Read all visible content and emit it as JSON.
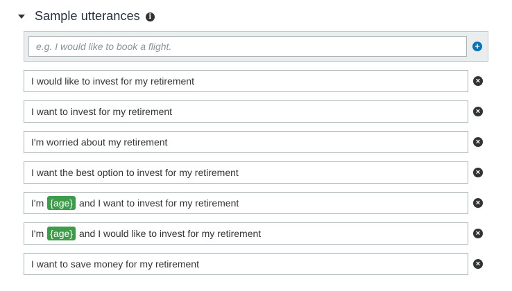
{
  "section": {
    "title": "Sample utterances",
    "info_icon": "info-icon",
    "collapse_icon": "caret-down-icon"
  },
  "new_utterance": {
    "placeholder": "e.g. I would like to book a flight.",
    "add_icon": "plus-circle-icon",
    "add_symbol": "+"
  },
  "remove_symbol": "×",
  "utterances": [
    {
      "prefix": "I would like to invest for my retirement",
      "slot": "",
      "suffix": ""
    },
    {
      "prefix": "I want to invest for my retirement",
      "slot": "",
      "suffix": ""
    },
    {
      "prefix": "I'm worried about my retirement",
      "slot": "",
      "suffix": ""
    },
    {
      "prefix": "I want the best option to invest for my retirement",
      "slot": "",
      "suffix": ""
    },
    {
      "prefix": "I'm",
      "slot": "{age}",
      "suffix": "and I want to invest for my retirement"
    },
    {
      "prefix": "I'm",
      "slot": "{age}",
      "suffix": "and I would like to invest for my retirement"
    },
    {
      "prefix": "I want to save money for my retirement",
      "slot": "",
      "suffix": ""
    }
  ],
  "colors": {
    "slot_bg": "#3d9c48",
    "add_button": "#0073bb",
    "remove_button": "#333333"
  }
}
